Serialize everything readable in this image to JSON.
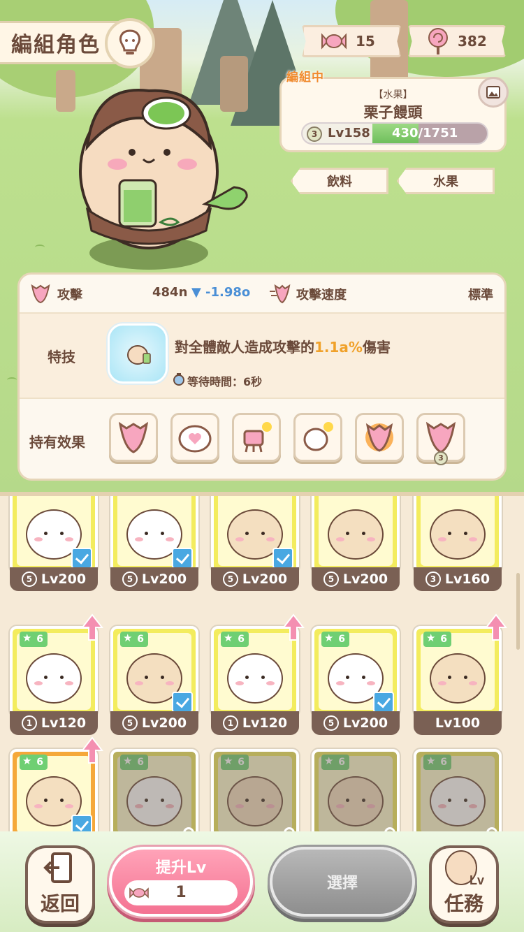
{
  "header": {
    "title": "編組角色"
  },
  "currency": {
    "candy": "15",
    "lollipop": "382"
  },
  "character": {
    "editing_tag": "編組中",
    "type": "【水果】",
    "name": "栗子饅頭",
    "rank": "3",
    "level": "Lv158",
    "exp": "430/1751",
    "exp_fraction": 0.246
  },
  "tabs": {
    "drink": "飲料",
    "fruit": "水果"
  },
  "stats": {
    "attack_label": "攻擊",
    "attack_value": "484n",
    "attack_delta": "-1.98o",
    "speed_label": "攻擊速度",
    "speed_value": "標準",
    "skill_label": "特技",
    "skill_desc_prefix": "對全體敵人造成攻擊的",
    "skill_highlight": "1.1a%",
    "skill_desc_suffix": "傷害",
    "wait_label": "等待時間：6秒",
    "effects_label": "持有效果",
    "effect_badge": "3"
  },
  "grid": [
    {
      "rank": "5",
      "level": "Lv200",
      "checked": true,
      "face": "white"
    },
    {
      "rank": "5",
      "level": "Lv200",
      "checked": true,
      "face": "white"
    },
    {
      "rank": "5",
      "level": "Lv200",
      "checked": true,
      "face": "tan"
    },
    {
      "rank": "5",
      "level": "Lv200",
      "checked": false,
      "face": "tan"
    },
    {
      "rank": "3",
      "level": "Lv160",
      "checked": false,
      "face": "tan"
    },
    {
      "star": "6",
      "rank": "1",
      "level": "Lv120",
      "checked": false,
      "up": true,
      "face": "white"
    },
    {
      "star": "6",
      "rank": "5",
      "level": "Lv200",
      "checked": true,
      "face": "tan"
    },
    {
      "star": "6",
      "rank": "1",
      "level": "Lv120",
      "checked": false,
      "up": true,
      "face": "white"
    },
    {
      "star": "6",
      "rank": "5",
      "level": "Lv200",
      "checked": true,
      "face": "white"
    },
    {
      "star": "6",
      "rank": "",
      "level": "Lv100",
      "checked": false,
      "up": true,
      "face": "tan"
    },
    {
      "star": "6",
      "checked": true,
      "up": true,
      "face": "tan",
      "selected": true
    },
    {
      "star": "6",
      "locked": true,
      "face": "white"
    },
    {
      "star": "6",
      "locked": true,
      "face": "tan"
    },
    {
      "star": "6",
      "locked": true,
      "face": "tan"
    },
    {
      "star": "6",
      "locked": true,
      "face": "white"
    }
  ],
  "bottom": {
    "back_label": "返回",
    "levelup_label": "提升Lv",
    "levelup_amount": "1",
    "select_label": "選擇",
    "mission_label": "任務",
    "mission_badge": "Lv"
  }
}
